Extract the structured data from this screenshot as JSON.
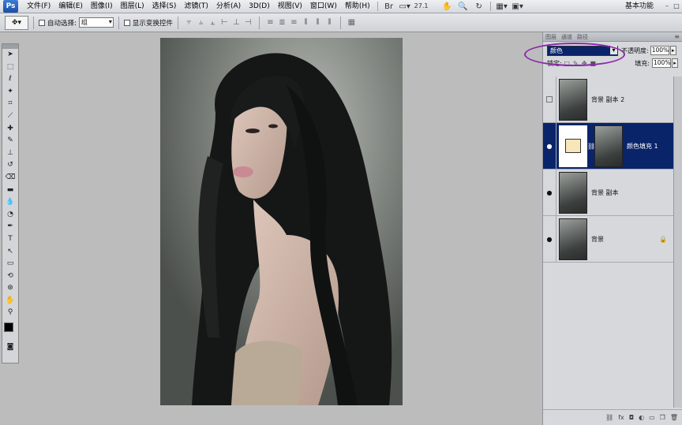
{
  "app": {
    "logo_text": "Ps",
    "workspace_label": "基本功能"
  },
  "menu": {
    "items": [
      "文件(F)",
      "编辑(E)",
      "图像(I)",
      "图层(L)",
      "选择(S)",
      "滤镜(T)",
      "分析(A)",
      "3D(D)",
      "视图(V)",
      "窗口(W)",
      "帮助(H)"
    ],
    "zoom_value": "27.1"
  },
  "options": {
    "auto_select_label": "自动选择:",
    "auto_select_value": "组",
    "show_transform_label": "显示变换控件"
  },
  "layers_panel": {
    "tabs": [
      "图层",
      "通道",
      "路径"
    ],
    "blend_mode": "颜色",
    "opacity_label": "不透明度:",
    "opacity_value": "100%",
    "lock_label": "锁定:",
    "fill_label": "填充:",
    "fill_value": "100%",
    "layers": [
      {
        "name": "背景 副本 2",
        "visible": false,
        "selected": false,
        "type": "image"
      },
      {
        "name": "颜色填充 1",
        "visible": true,
        "selected": true,
        "type": "fill",
        "fill_color": "#f8e6b8"
      },
      {
        "name": "背景 副本",
        "visible": true,
        "selected": false,
        "type": "image"
      },
      {
        "name": "背景",
        "visible": true,
        "selected": false,
        "type": "image",
        "locked": true
      }
    ]
  },
  "colors": {
    "selection": "#0a246a",
    "highlight": "#8b2aa8",
    "foreground": "#000000",
    "background": "#ffffff"
  }
}
